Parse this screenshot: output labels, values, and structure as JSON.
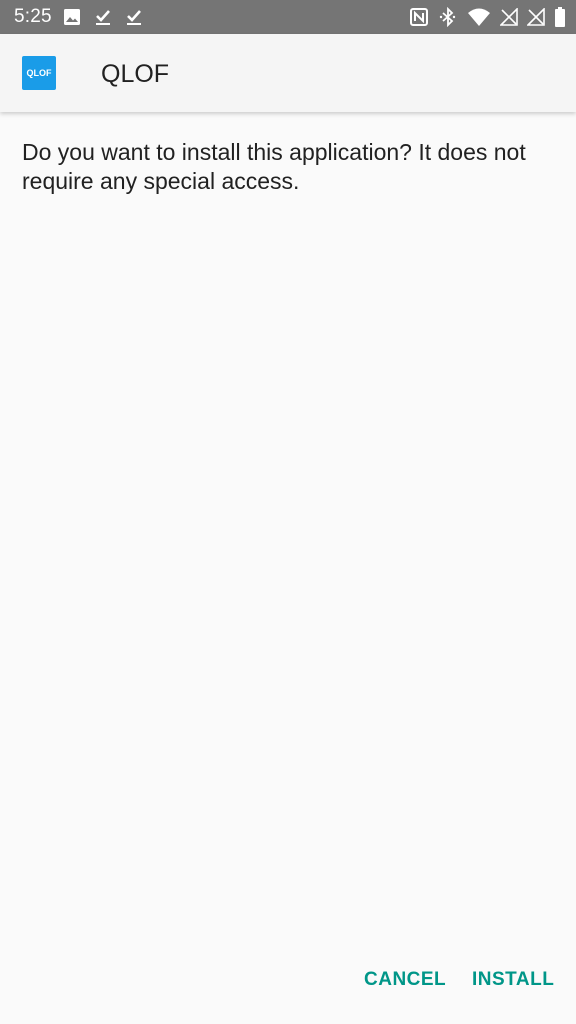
{
  "status_bar": {
    "time": "5:25",
    "left_icons": [
      "image-icon",
      "download-done-icon",
      "download-done-icon"
    ],
    "right_icons": [
      "nfc-icon",
      "bluetooth-icon",
      "wifi-icon",
      "signal-no-sim-icon",
      "signal-no-sim-icon",
      "battery-icon"
    ]
  },
  "header": {
    "app_icon_text": "QLOF",
    "app_name": "QLOF"
  },
  "message": "Do you want to install this application? It does not require any special access.",
  "buttons": {
    "cancel": "CANCEL",
    "install": "INSTALL"
  },
  "colors": {
    "status_bar": "#757575",
    "accent": "#009688",
    "app_icon": "#1a9ce8",
    "background": "#fafafa"
  }
}
